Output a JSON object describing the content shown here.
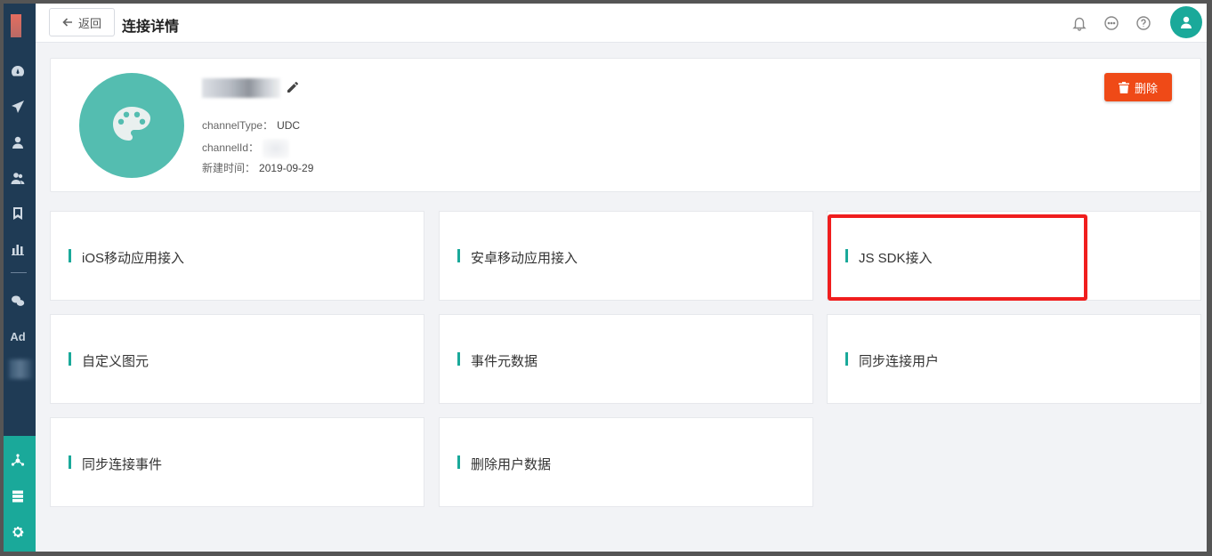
{
  "header": {
    "back_label": "返回",
    "title": "连接详情",
    "icons": [
      "bell-icon",
      "chat-icon",
      "help-icon",
      "user-avatar-icon"
    ]
  },
  "sidebar": {
    "items": [
      {
        "icon": "dashboard-icon"
      },
      {
        "icon": "send-icon"
      },
      {
        "icon": "user-icon"
      },
      {
        "icon": "users-icon"
      },
      {
        "icon": "bookmark-icon"
      },
      {
        "icon": "bar-chart-icon"
      },
      {
        "icon": "wechat-icon"
      },
      {
        "icon": "ad-icon",
        "label": "Ad"
      }
    ],
    "bottom_items": [
      {
        "icon": "connection-icon"
      },
      {
        "icon": "server-icon"
      },
      {
        "icon": "settings-icon"
      }
    ],
    "accent_color": "#1aa99a",
    "background_color": "#1f3b55"
  },
  "info": {
    "channel_type_label": "channelType：",
    "channel_type_value": "UDC",
    "channel_id_label": "channelId：",
    "created_label": "新建时间：",
    "created_value": "2019-09-29",
    "delete_label": "删除",
    "delete_color": "#ef4a17"
  },
  "tiles": [
    {
      "label": "iOS移动应用接入"
    },
    {
      "label": "安卓移动应用接入"
    },
    {
      "label": "JS SDK接入"
    },
    {
      "label": "自定义图元"
    },
    {
      "label": "事件元数据"
    },
    {
      "label": "同步连接用户"
    },
    {
      "label": "同步连接事件"
    },
    {
      "label": "删除用户数据"
    }
  ],
  "highlight_color": "#f01e1e"
}
